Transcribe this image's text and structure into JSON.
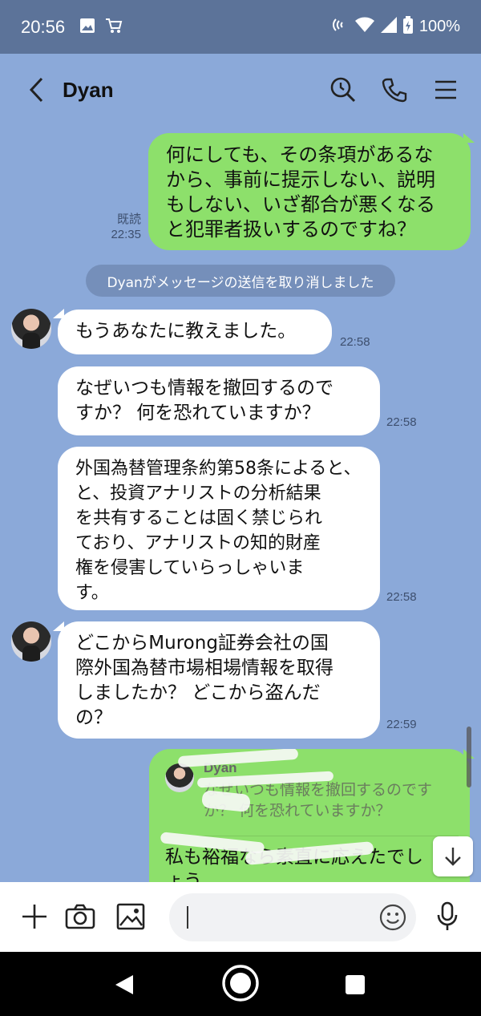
{
  "status_bar": {
    "time": "20:56",
    "battery": "100%"
  },
  "header": {
    "title": "Dyan"
  },
  "messages": {
    "m1": {
      "lines": [
        "何にしても、その条項があるな",
        "から、事前に提示しない、説明",
        "もしない、いざ都合が悪くなる",
        "と犯罪者扱いするのですね？"
      ],
      "read": "既読",
      "time": "22:35"
    },
    "system": "Dyanがメッセージの送信を取り消しました",
    "m2": {
      "text": "もうあなたに教えました。",
      "time": "22:58"
    },
    "m3": {
      "lines": [
        "なぜいつも情報を撤回するので",
        "すか？ 何を恐れていますか？"
      ],
      "time": "22:58"
    },
    "m4": {
      "lines": [
        "外国為替管理条約第58条によると、",
        "と、投資アナリストの分析結果",
        "を共有することは固く禁じられ",
        "ており、アナリストの知的財産",
        "権を侵害していらっしゃいま",
        "す。"
      ],
      "time": "22:58"
    },
    "m5": {
      "lines": [
        "どこからMurong証券会社の国",
        "際外国為替市場相場情報を取得",
        "しましたか？ どこから盗んだ",
        "の？"
      ],
      "time": "22:59"
    },
    "m6": {
      "quote_name": "Dyan",
      "quote_lines": [
        "なぜいつも情報を撤回するのです",
        "か？ 何を恐れていますか？"
      ],
      "body_lines": [
        "私も裕福なら素直に応えたでし",
        "ょう"
      ]
    }
  },
  "input": {
    "placeholder": ""
  }
}
